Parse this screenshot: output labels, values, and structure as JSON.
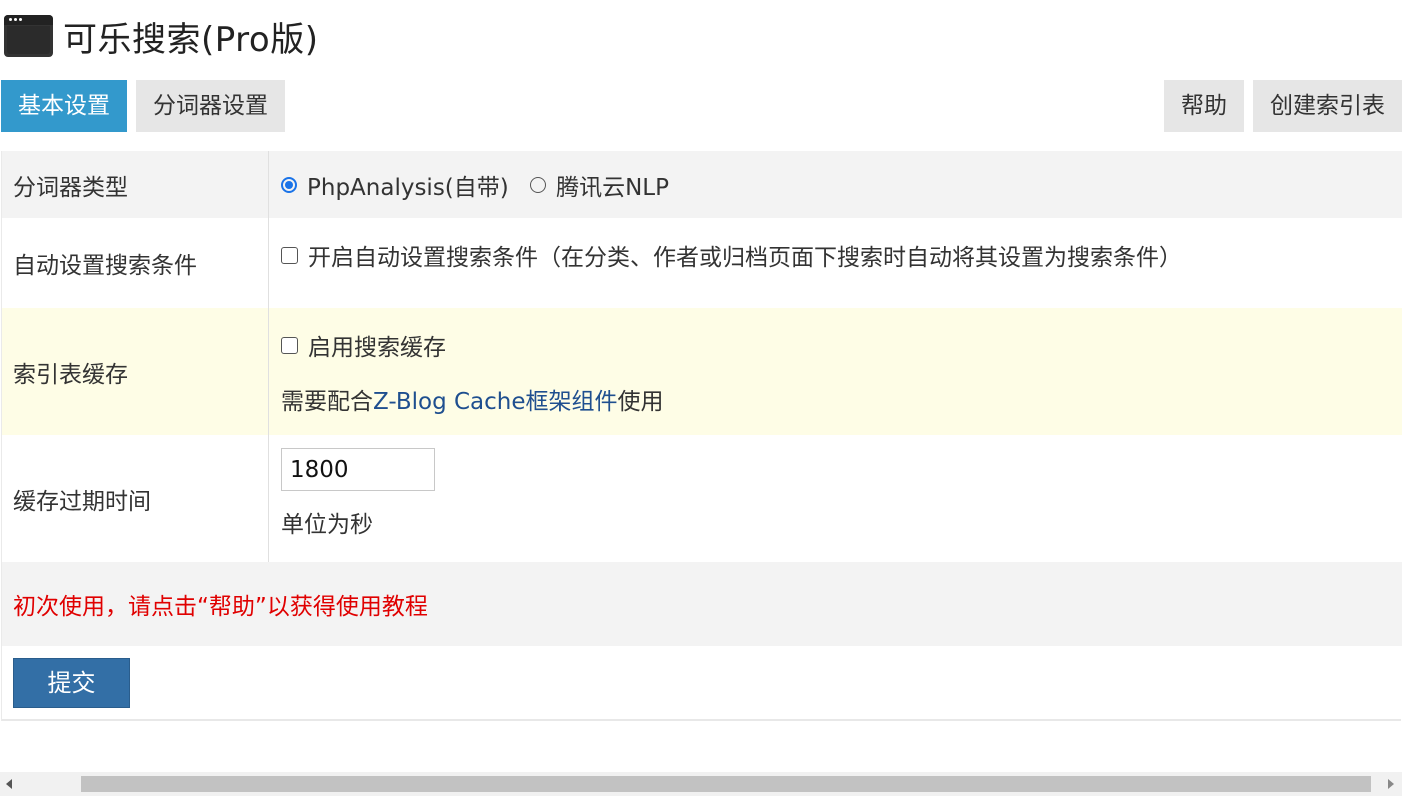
{
  "header": {
    "title": "可乐搜索(Pro版)",
    "icon": "app-window-icon"
  },
  "tabs": [
    {
      "label": "基本设置",
      "active": true
    },
    {
      "label": "分词器设置",
      "active": false
    }
  ],
  "actions": {
    "help": "帮助",
    "create_index": "创建索引表"
  },
  "form": {
    "segmenter": {
      "label": "分词器类型",
      "options": [
        {
          "label": "PhpAnalysis(自带)",
          "checked": true
        },
        {
          "label": "腾讯云NLP",
          "checked": false
        }
      ]
    },
    "auto_condition": {
      "label": "自动设置搜索条件",
      "checkbox_label": "开启自动设置搜索条件（在分类、作者或归档页面下搜索时自动将其设置为搜索条件）",
      "checked": false
    },
    "index_cache": {
      "label": "索引表缓存",
      "checkbox_label": "启用搜索缓存",
      "checked": false,
      "note_prefix": "需要配合",
      "note_link": "Z-Blog Cache框架组件",
      "note_suffix": "使用"
    },
    "cache_expire": {
      "label": "缓存过期时间",
      "value": "1800",
      "unit_note": "单位为秒"
    },
    "notice": "初次使用，请点击“帮助”以获得使用教程",
    "submit_label": "提交"
  },
  "colors": {
    "accent": "#3399cc",
    "submit": "#336fa6",
    "notice": "#e00000",
    "highlight_row": "#fefde6"
  }
}
